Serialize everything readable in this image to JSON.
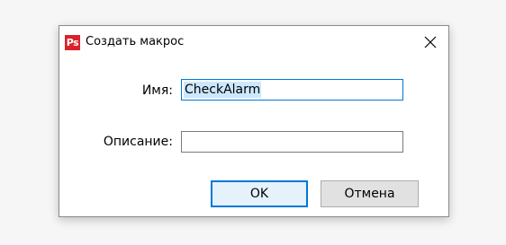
{
  "dialog": {
    "app_icon_text": "Ps",
    "title": "Создать макрос",
    "close_icon": "close-icon"
  },
  "form": {
    "name_label": "Имя:",
    "name_value": "CheckAlarm",
    "description_label": "Описание:",
    "description_value": ""
  },
  "buttons": {
    "ok_label": "OK",
    "cancel_label": "Отмена"
  },
  "colors": {
    "app_icon": "#d8232a",
    "accent": "#0078d7",
    "selection": "#cce8ff"
  }
}
